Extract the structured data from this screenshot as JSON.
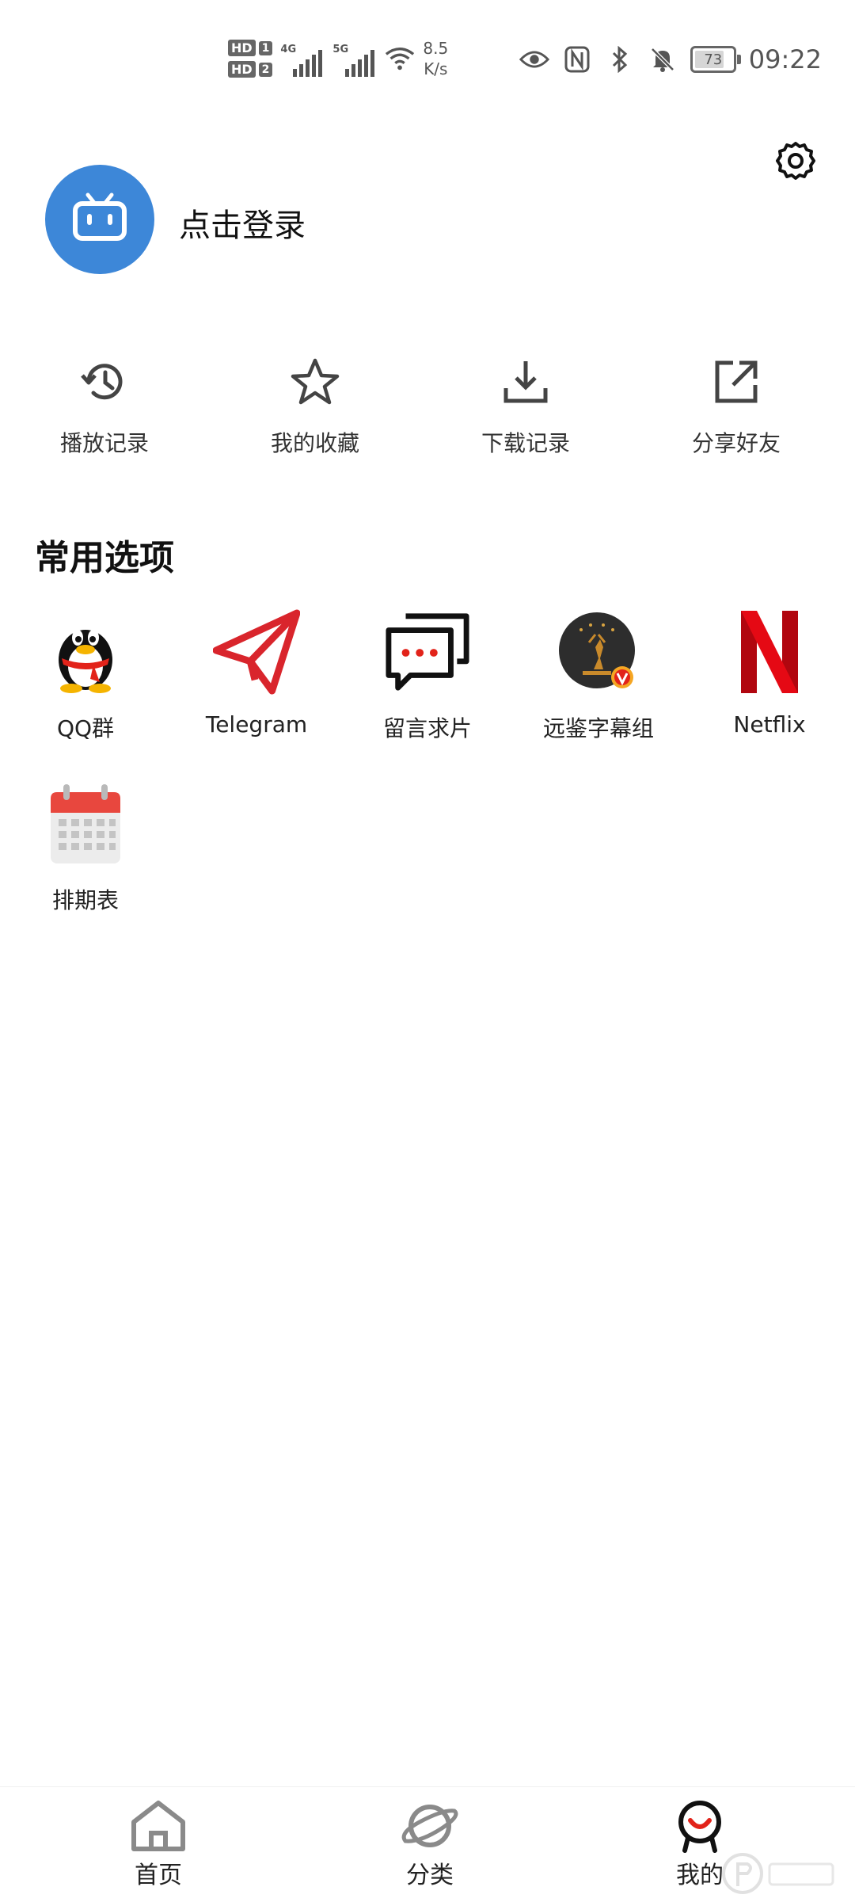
{
  "status_bar": {
    "sim1": {
      "hd": "HD",
      "slot": "1",
      "network": "4G"
    },
    "sim2": {
      "hd": "HD",
      "slot": "2",
      "network": "5G"
    },
    "speed_value": "8.5",
    "speed_unit": "K/s",
    "battery": "73",
    "time": "09:22",
    "icons": [
      "eye-icon",
      "nfc-icon",
      "bluetooth-icon",
      "bell-off-icon"
    ]
  },
  "profile": {
    "login_text": "点击登录",
    "avatar_icon": "tv-icon",
    "settings_icon": "gear-icon",
    "avatar_color": "#3d87d8"
  },
  "quick_actions": [
    {
      "label": "播放记录",
      "icon": "history-icon"
    },
    {
      "label": "我的收藏",
      "icon": "star-icon"
    },
    {
      "label": "下载记录",
      "icon": "download-icon"
    },
    {
      "label": "分享好友",
      "icon": "share-icon"
    }
  ],
  "section": {
    "title": "常用选项"
  },
  "options": [
    {
      "label": "QQ群",
      "icon": "qq-penguin-icon"
    },
    {
      "label": "Telegram",
      "icon": "telegram-icon"
    },
    {
      "label": "留言求片",
      "icon": "message-icon"
    },
    {
      "label": "远鉴字幕组",
      "icon": "subtitle-group-icon"
    },
    {
      "label": "Netflix",
      "icon": "netflix-icon"
    },
    {
      "label": "排期表",
      "icon": "calendar-icon"
    }
  ],
  "bottom_nav": [
    {
      "label": "首页",
      "icon": "home-icon",
      "active": false
    },
    {
      "label": "分类",
      "icon": "planet-icon",
      "active": false
    },
    {
      "label": "我的",
      "icon": "smile-person-icon",
      "active": true
    }
  ],
  "colors": {
    "accent_red": "#e2231a",
    "netflix_red": "#e50914",
    "telegram_red": "#d9252c"
  }
}
